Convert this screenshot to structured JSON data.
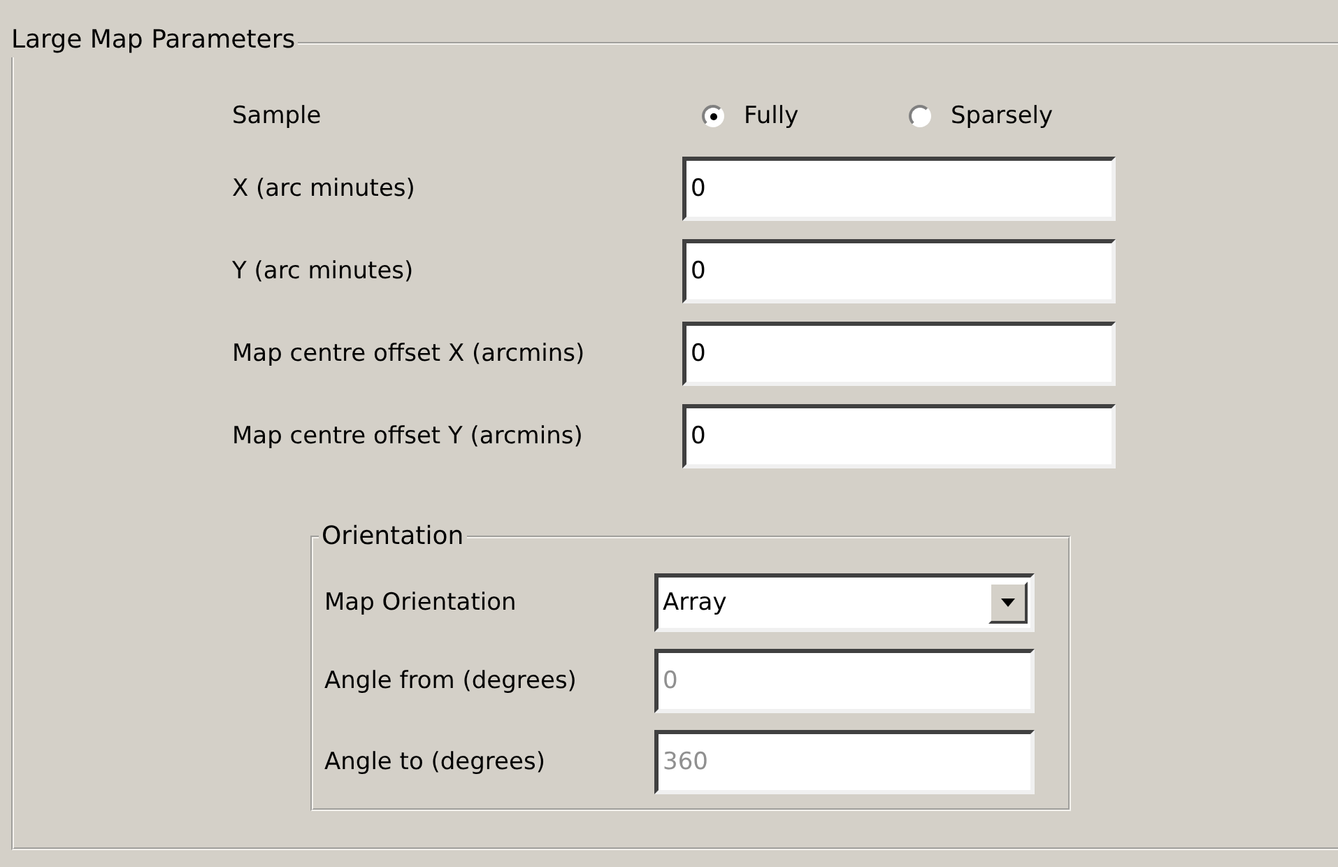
{
  "group": {
    "title": "Large Map Parameters"
  },
  "sample": {
    "label": "Sample",
    "options": [
      {
        "label": "Fully",
        "selected": true
      },
      {
        "label": "Sparsely",
        "selected": false
      }
    ]
  },
  "fields": [
    {
      "label": "X (arc minutes)",
      "value": "0"
    },
    {
      "label": "Y (arc minutes)",
      "value": "0"
    },
    {
      "label": "Map centre offset X (arcmins)",
      "value": "0"
    },
    {
      "label": "Map centre offset Y (arcmins)",
      "value": "0"
    }
  ],
  "orientation": {
    "title": "Orientation",
    "map_orientation": {
      "label": "Map Orientation",
      "value": "Array"
    },
    "fields": [
      {
        "label": "Angle from (degrees)",
        "value": "0",
        "disabled": true
      },
      {
        "label": "Angle to (degrees)",
        "value": "360",
        "disabled": true
      }
    ]
  }
}
